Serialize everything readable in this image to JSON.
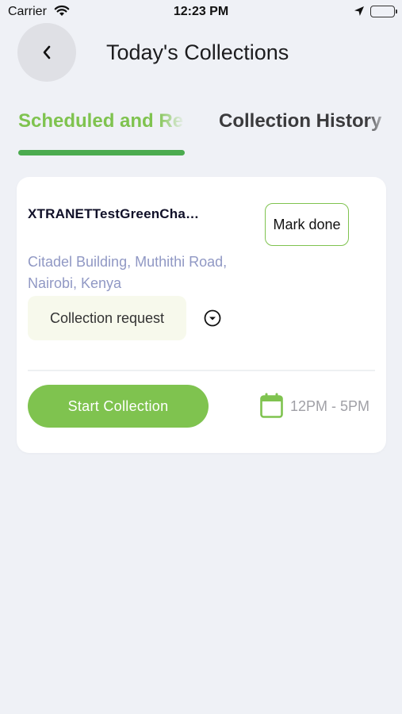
{
  "status_bar": {
    "carrier": "Carrier",
    "time": "12:23 PM"
  },
  "header": {
    "title": "Today's Collections",
    "back_icon": "chevron-left-icon"
  },
  "tabs": [
    {
      "label": "Scheduled and Re",
      "active": true
    },
    {
      "label": "Collection History",
      "active": false
    }
  ],
  "card": {
    "site_name": "XTRANETTestGreenCha…",
    "mark_done_label": "Mark done",
    "address": "Citadel Building, Muthithi Road, Nairobi, Kenya",
    "chip_label": "Collection request",
    "start_button_label": "Start Collection",
    "time_range": "12PM - 5PM"
  },
  "colors": {
    "accent": "#7fc34f",
    "tab_indicator": "#4bab4f",
    "address_text": "#9098c4",
    "background": "#eff1f6"
  }
}
